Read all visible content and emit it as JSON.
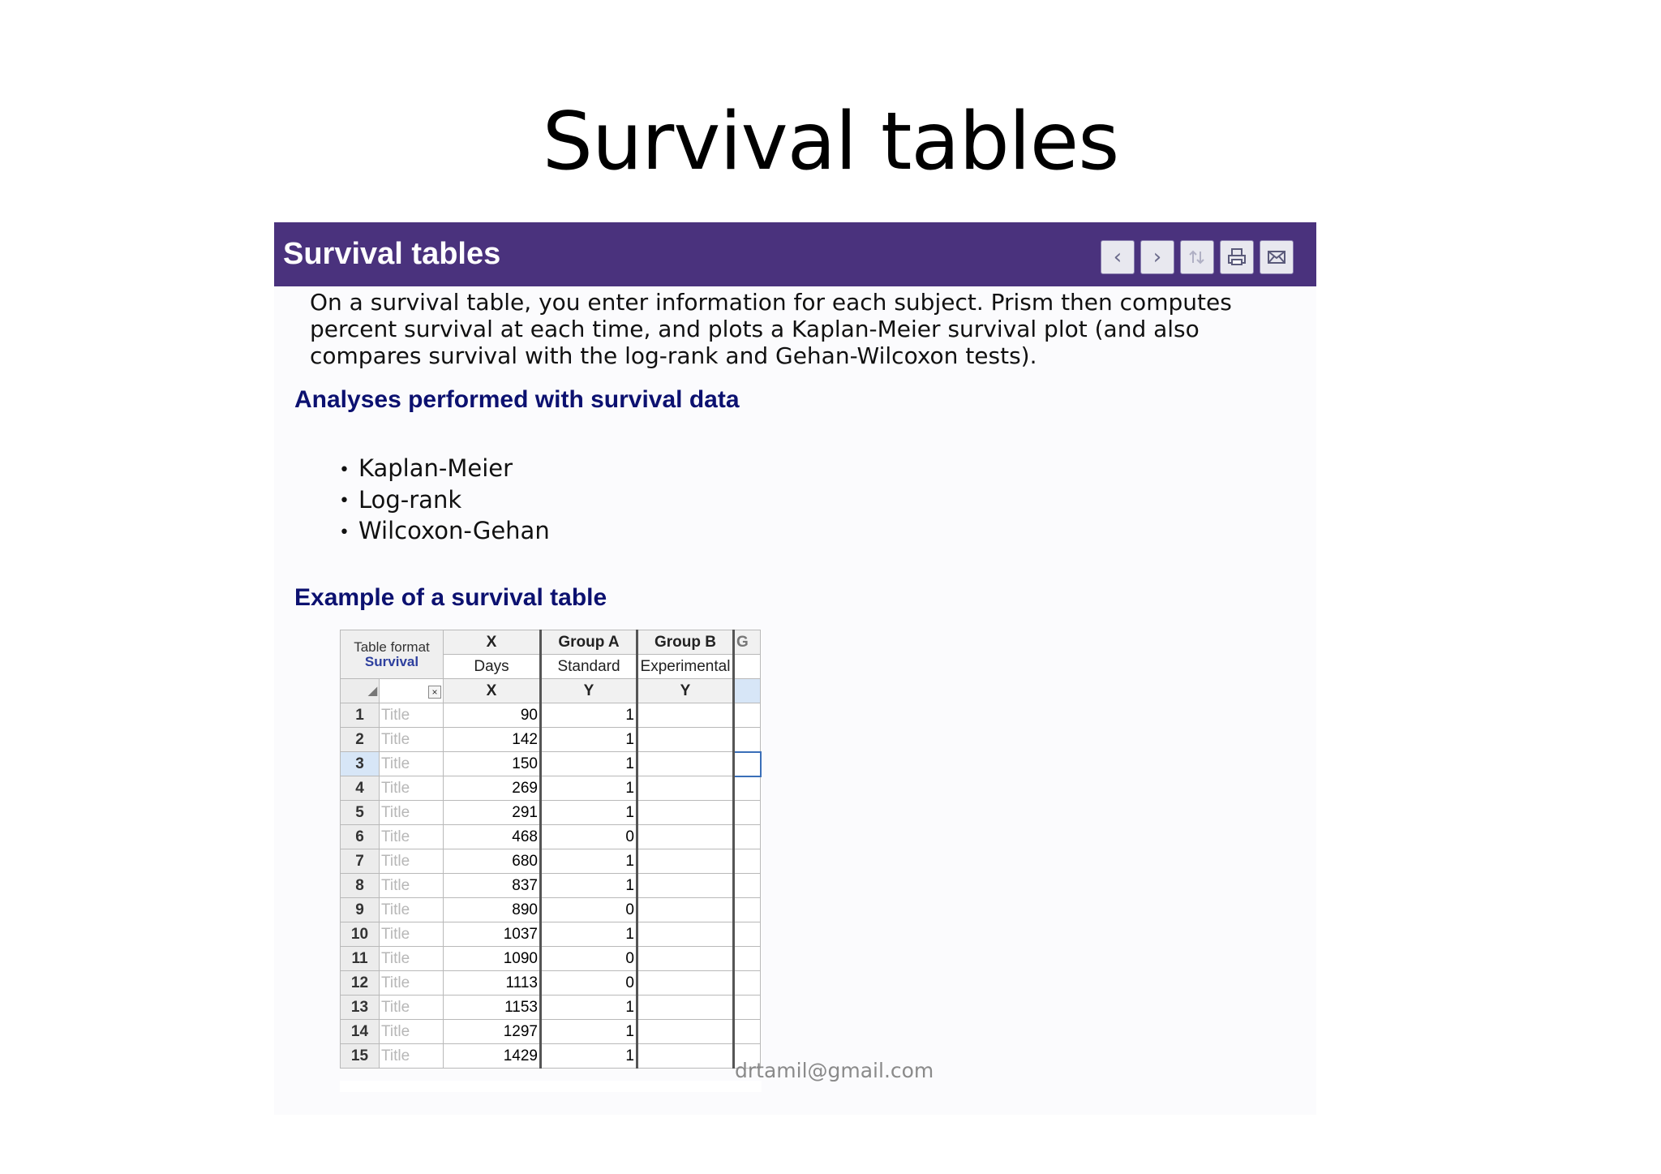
{
  "slide": {
    "title": "Survival tables",
    "footer_email": "drtamil@gmail.com"
  },
  "help": {
    "header_title": "Survival tables",
    "nav_icons": [
      "chevron-left-icon",
      "chevron-right-icon",
      "sort-arrows-icon",
      "print-icon",
      "email-icon"
    ],
    "nav_prev": "‹",
    "nav_next": "›",
    "intro": "On a survival table, you enter information for each subject. Prism then computes percent survival at each time, and plots a Kaplan-Meier survival plot (and also compares survival with the log-rank and Gehan-Wilcoxon tests).",
    "analyses_heading": "Analyses performed with survival data",
    "analyses": [
      "Kaplan-Meier",
      "Log-rank",
      "Wilcoxon-Gehan"
    ],
    "example_heading": "Example of a survival table"
  },
  "table": {
    "format_label": "Table format",
    "format_value": "Survival",
    "columns": [
      {
        "title": "X",
        "subtitle": "Days",
        "type": "X"
      },
      {
        "title": "Group A",
        "subtitle": "Standard",
        "type": "Y"
      },
      {
        "title": "Group B",
        "subtitle": "Experimental",
        "type": "Y"
      },
      {
        "title": "G",
        "subtitle": "",
        "type": ""
      }
    ],
    "row_title_placeholder": "Title",
    "rows": [
      {
        "n": "1",
        "title": "Title",
        "x": "90",
        "a": "1"
      },
      {
        "n": "2",
        "title": "Title",
        "x": "142",
        "a": "1"
      },
      {
        "n": "3",
        "title": "Title",
        "x": "150",
        "a": "1"
      },
      {
        "n": "4",
        "title": "Title",
        "x": "269",
        "a": "1"
      },
      {
        "n": "5",
        "title": "Title",
        "x": "291",
        "a": "1"
      },
      {
        "n": "6",
        "title": "Title",
        "x": "468",
        "a": "0"
      },
      {
        "n": "7",
        "title": "Title",
        "x": "680",
        "a": "1"
      },
      {
        "n": "8",
        "title": "Title",
        "x": "837",
        "a": "1"
      },
      {
        "n": "9",
        "title": "Title",
        "x": "890",
        "a": "0"
      },
      {
        "n": "10",
        "title": "Title",
        "x": "1037",
        "a": "1"
      },
      {
        "n": "11",
        "title": "Title",
        "x": "1090",
        "a": "0"
      },
      {
        "n": "12",
        "title": "Title",
        "x": "1113",
        "a": "0"
      },
      {
        "n": "13",
        "title": "Title",
        "x": "1153",
        "a": "1"
      },
      {
        "n": "14",
        "title": "Title",
        "x": "1297",
        "a": "1"
      },
      {
        "n": "15",
        "title": "Title",
        "x": "1429",
        "a": "1"
      }
    ],
    "selected_row": "3"
  }
}
